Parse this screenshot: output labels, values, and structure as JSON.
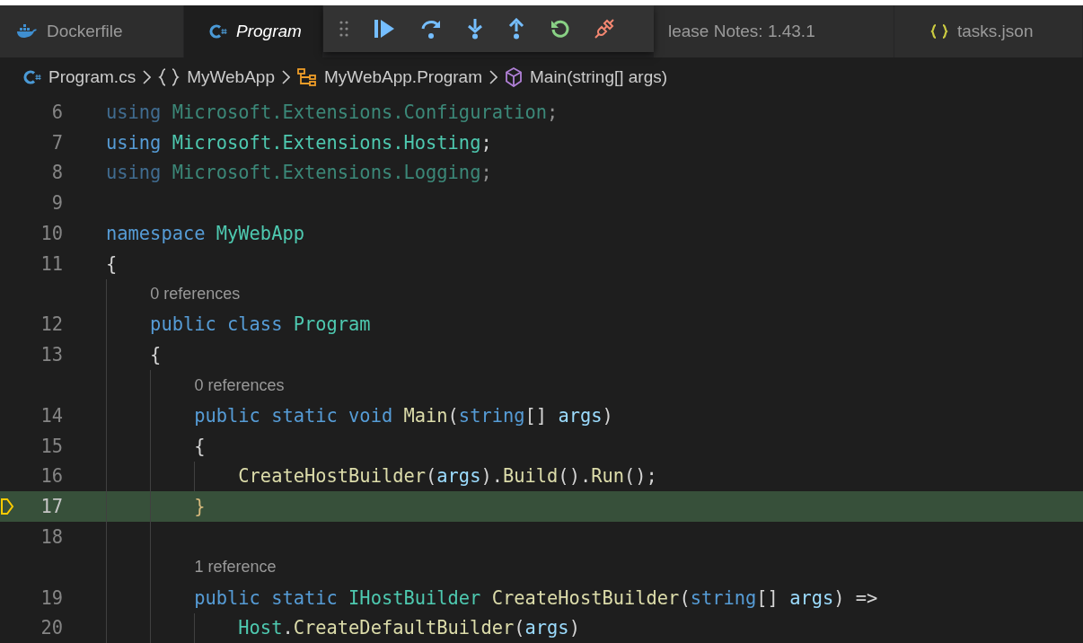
{
  "tabs": [
    {
      "label": "Dockerfile",
      "kind": "docker",
      "selected": false
    },
    {
      "label": "Program",
      "kind": "csharp",
      "selected": true
    },
    {
      "label": "lease Notes: 1.43.1",
      "kind": "covered",
      "selected": false
    },
    {
      "label": "tasks.json",
      "kind": "json",
      "selected": false
    }
  ],
  "breadcrumb": [
    {
      "label": "Program.cs",
      "kind": "file"
    },
    {
      "label": "MyWebApp",
      "kind": "namespace"
    },
    {
      "label": "MyWebApp.Program",
      "kind": "class"
    },
    {
      "label": "Main(string[] args)",
      "kind": "method"
    }
  ],
  "code_lines": [
    {
      "kind": "code",
      "number": "6",
      "faded": true,
      "current": false,
      "tokens": [
        {
          "text": "using ",
          "kind": "keyword"
        },
        {
          "text": "Microsoft.Extensions.Configuration",
          "kind": "type"
        },
        {
          "text": ";",
          "kind": "plain"
        }
      ]
    },
    {
      "kind": "code",
      "number": "7",
      "faded": false,
      "current": false,
      "tokens": [
        {
          "text": "using ",
          "kind": "keyword"
        },
        {
          "text": "Microsoft.Extensions.Hosting",
          "kind": "type"
        },
        {
          "text": ";",
          "kind": "plain"
        }
      ]
    },
    {
      "kind": "code",
      "number": "8",
      "faded": true,
      "current": false,
      "tokens": [
        {
          "text": "using ",
          "kind": "keyword"
        },
        {
          "text": "Microsoft.Extensions.Logging",
          "kind": "type"
        },
        {
          "text": ";",
          "kind": "plain"
        }
      ]
    },
    {
      "kind": "code",
      "number": "9",
      "current": false
    },
    {
      "kind": "code",
      "number": "10",
      "faded": false,
      "current": false,
      "tokens": [
        {
          "text": "namespace ",
          "kind": "keyword"
        },
        {
          "text": "MyWebApp",
          "kind": "type"
        }
      ]
    },
    {
      "kind": "code",
      "number": "11",
      "faded": false,
      "current": false,
      "tokens": [
        {
          "text": "{",
          "kind": "plain"
        }
      ]
    },
    {
      "kind": "codelens",
      "text": "0 references"
    },
    {
      "kind": "code",
      "number": "12",
      "faded": false,
      "current": false,
      "tokens": [
        {
          "text": "    public class ",
          "kind": "keyword"
        },
        {
          "text": "Program",
          "kind": "type"
        }
      ]
    },
    {
      "kind": "code",
      "number": "13",
      "faded": false,
      "current": false,
      "tokens": [
        {
          "text": "    {",
          "kind": "plain"
        }
      ]
    },
    {
      "kind": "codelens",
      "text": "0 references"
    },
    {
      "kind": "code",
      "number": "14",
      "faded": false,
      "current": false,
      "tokens": [
        {
          "text": "        public static void ",
          "kind": "keyword"
        },
        {
          "text": "Main",
          "kind": "function"
        },
        {
          "text": "(",
          "kind": "plain"
        },
        {
          "text": "string",
          "kind": "keyword"
        },
        {
          "text": "[] ",
          "kind": "plain"
        },
        {
          "text": "args",
          "kind": "param"
        },
        {
          "text": ")",
          "kind": "plain"
        }
      ]
    },
    {
      "kind": "code",
      "number": "15",
      "faded": false,
      "current": false,
      "tokens": [
        {
          "text": "        {",
          "kind": "plain"
        }
      ]
    },
    {
      "kind": "code",
      "number": "16",
      "faded": false,
      "current": false,
      "tokens": [
        {
          "text": "            CreateHostBuilder",
          "kind": "function"
        },
        {
          "text": "(",
          "kind": "plain"
        },
        {
          "text": "args",
          "kind": "param"
        },
        {
          "text": ").",
          "kind": "plain"
        },
        {
          "text": "Build",
          "kind": "function"
        },
        {
          "text": "().",
          "kind": "plain"
        },
        {
          "text": "Run",
          "kind": "function"
        },
        {
          "text": "();",
          "kind": "plain"
        }
      ]
    },
    {
      "kind": "code",
      "number": "17",
      "faded": false,
      "current": true,
      "tokens": [
        {
          "text": "        }",
          "kind": "brace"
        }
      ]
    },
    {
      "kind": "code",
      "number": "18",
      "current": false
    },
    {
      "kind": "codelens",
      "text": "1 reference"
    },
    {
      "kind": "code",
      "number": "19",
      "faded": false,
      "current": false,
      "tokens": [
        {
          "text": "        public static ",
          "kind": "keyword"
        },
        {
          "text": "IHostBuilder ",
          "kind": "type"
        },
        {
          "text": "CreateHostBuilder",
          "kind": "function"
        },
        {
          "text": "(",
          "kind": "plain"
        },
        {
          "text": "string",
          "kind": "keyword"
        },
        {
          "text": "[] ",
          "kind": "plain"
        },
        {
          "text": "args",
          "kind": "param"
        },
        {
          "text": ") =>",
          "kind": "plain"
        }
      ]
    },
    {
      "kind": "code",
      "number": "20",
      "faded": false,
      "current": false,
      "tokens": [
        {
          "text": "            Host",
          "kind": "type"
        },
        {
          "text": ".",
          "kind": "plain"
        },
        {
          "text": "CreateDefaultBuilder",
          "kind": "function"
        },
        {
          "text": "(",
          "kind": "plain"
        },
        {
          "text": "args",
          "kind": "param"
        },
        {
          "text": ")",
          "kind": "plain"
        }
      ]
    }
  ]
}
